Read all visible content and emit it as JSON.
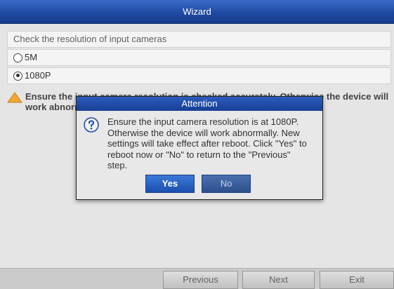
{
  "window": {
    "title": "Wizard"
  },
  "section": {
    "heading": "Check the resolution of input cameras"
  },
  "options": [
    {
      "label": "5M",
      "selected": false
    },
    {
      "label": "1080P",
      "selected": true
    }
  ],
  "warning": {
    "icon": "warning-triangle-icon",
    "text": "Ensure the input camera resolution is checked accurately. Otherwise the device will work abnormally."
  },
  "dialog": {
    "title": "Attention",
    "icon": "question-icon",
    "message": "Ensure the input camera resolution is at 1080P. Otherwise the device will work abnormally. New settings will take effect after reboot. Click \"Yes\" to reboot now or \"No\" to return to the \"Previous\" step.",
    "yes_label": "Yes",
    "no_label": "No"
  },
  "footer": {
    "previous_label": "Previous",
    "next_label": "Next",
    "exit_label": "Exit"
  },
  "colors": {
    "title_blue": "#1f4aa3",
    "yes_blue": "#2a62c4",
    "warning_orange": "#f0a020"
  }
}
